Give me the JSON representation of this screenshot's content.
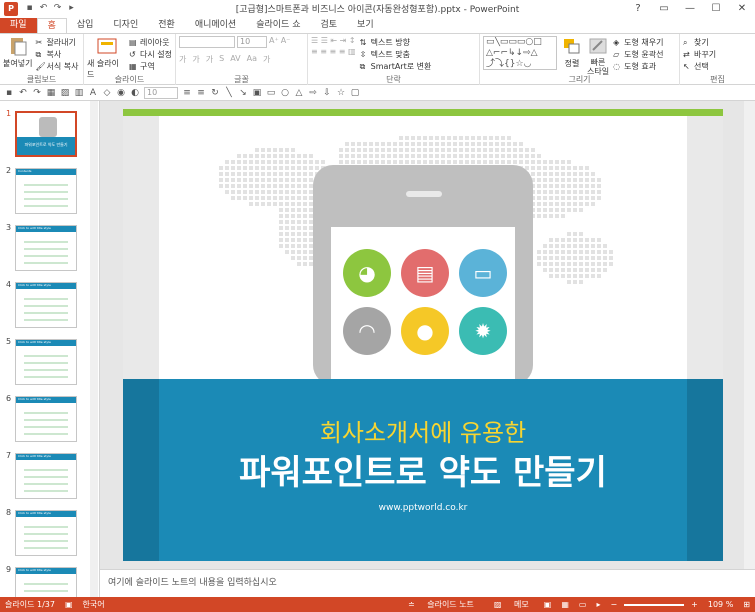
{
  "window": {
    "title": "[고급형]스마트폰과 비즈니스 아이콘(자동완성형포함).pptx - PowerPoint",
    "app_icon": "P",
    "controls": [
      "?",
      "▭",
      "—",
      "☐",
      "✕"
    ]
  },
  "tabs": [
    {
      "label": "파일"
    },
    {
      "label": "홈"
    },
    {
      "label": "삽입"
    },
    {
      "label": "디자인"
    },
    {
      "label": "전환"
    },
    {
      "label": "애니메이션"
    },
    {
      "label": "슬라이드 쇼"
    },
    {
      "label": "검토"
    },
    {
      "label": "보기"
    }
  ],
  "ribbon": {
    "clipboard": {
      "label": "클립보드",
      "paste": "붙여넣기",
      "cut": "잘라내기",
      "copy": "복사",
      "format_painter": "서식 복사"
    },
    "slides": {
      "label": "슬라이드",
      "new_slide": "새 슬라이드",
      "layout": "레이아웃",
      "reset": "다시 설정",
      "section": "구역"
    },
    "font": {
      "label": "글꼴",
      "size": "10"
    },
    "paragraph": {
      "label": "단락",
      "text_direction": "텍스트 방향",
      "align_text": "텍스트 맞춤",
      "smartart": "SmartArt로 변환"
    },
    "drawing": {
      "label": "그리기",
      "arrange": "정렬",
      "quick_styles": "빠른\n스타일",
      "fill": "도형 채우기",
      "outline": "도형 윤곽선",
      "effects": "도형 효과"
    },
    "editing": {
      "label": "편집",
      "find": "찾기",
      "replace": "바꾸기",
      "select": "선택"
    }
  },
  "toolbar2": {
    "font_size": "10"
  },
  "thumbnails": [
    {
      "num": "1",
      "title": "파워포인트로 약도 만들기"
    },
    {
      "num": "2",
      "title": "Contents"
    },
    {
      "num": "3",
      "title": "Click to edit title style"
    },
    {
      "num": "4",
      "title": "Click to edit title style"
    },
    {
      "num": "5",
      "title": "Click to edit title style"
    },
    {
      "num": "6",
      "title": "Click to edit title style"
    },
    {
      "num": "7",
      "title": "Click to edit title style"
    },
    {
      "num": "8",
      "title": "Click to edit title style"
    },
    {
      "num": "9",
      "title": "Click to edit title style"
    }
  ],
  "slide": {
    "subtitle": "회사소개서에 유용한",
    "title": "파워포인트로 약도 만들기",
    "url": "www.pptworld.co.kr",
    "accent_green": "#8dc63f",
    "band_color": "#1b8ab6",
    "subtitle_color": "#f7d531",
    "icons": [
      {
        "name": "globe-icon",
        "color": "#8dc63f"
      },
      {
        "name": "clipboard-icon",
        "color": "#e26d6d"
      },
      {
        "name": "briefcase-icon",
        "color": "#5bb3d8"
      },
      {
        "name": "wifi-icon",
        "color": "#a5a5a5"
      },
      {
        "name": "lightbulb-icon",
        "color": "#f5c827"
      },
      {
        "name": "gear-icon",
        "color": "#3bbcb3"
      }
    ]
  },
  "notes": {
    "placeholder": "여기에 슬라이드 노트의 내용을 입력하십시오"
  },
  "status": {
    "slide": "슬라이드 1/37",
    "language": "한국어",
    "notes": "슬라이드 노트",
    "comments": "메모",
    "zoom": "109 %"
  }
}
